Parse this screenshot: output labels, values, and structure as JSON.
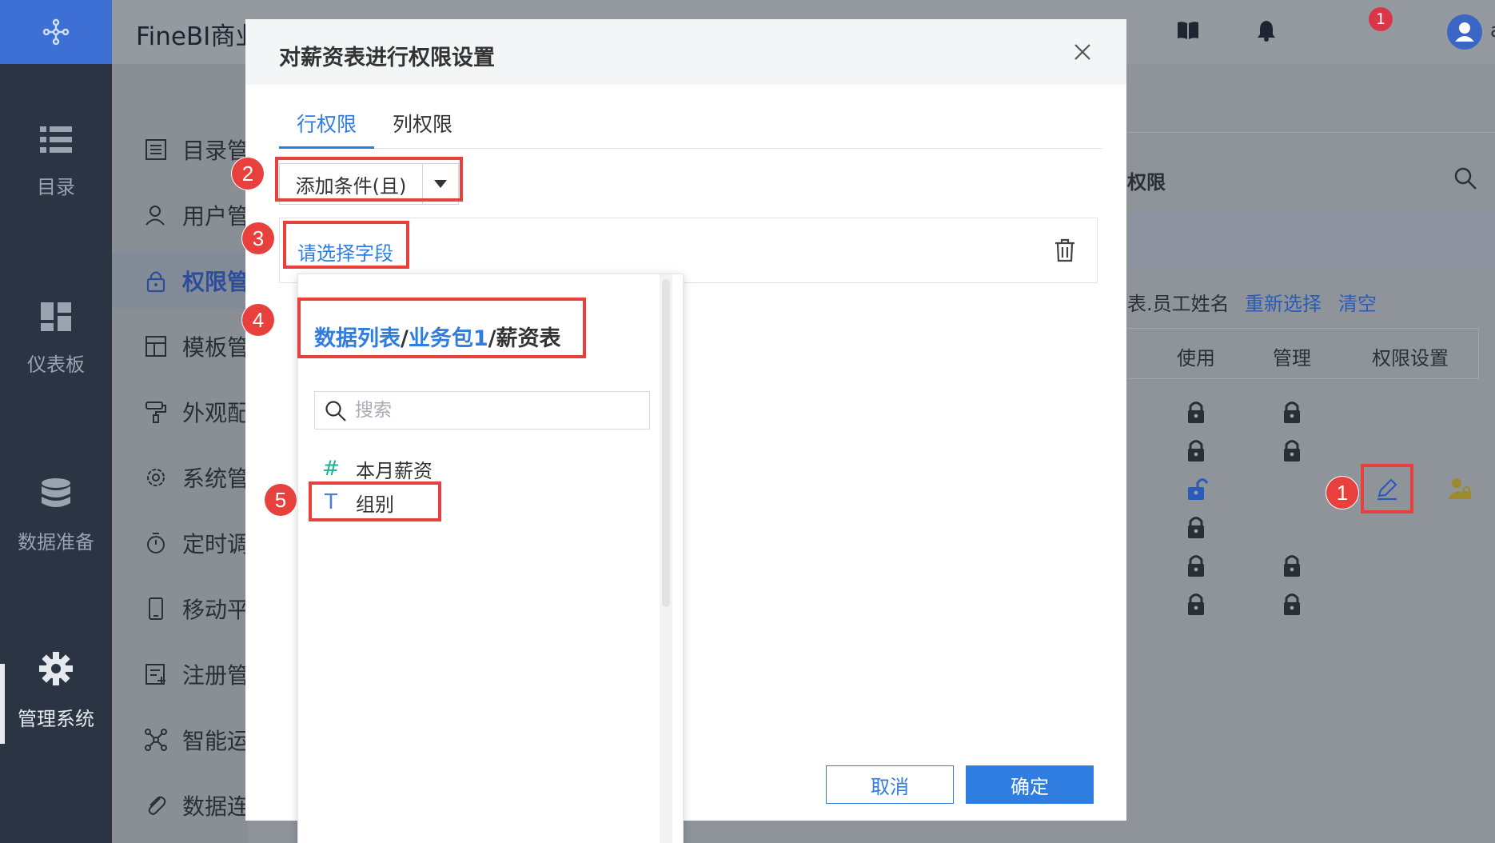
{
  "header": {
    "brand": "FineBI商业",
    "notification_count": "1",
    "username": "admin"
  },
  "nav": {
    "items": [
      {
        "label": "目录",
        "icon": "list-icon"
      },
      {
        "label": "仪表板",
        "icon": "dashboard-icon"
      },
      {
        "label": "数据准备",
        "icon": "database-icon"
      },
      {
        "label": "管理系统",
        "icon": "gear-icon"
      }
    ]
  },
  "sub_nav": {
    "items": [
      {
        "label": "目录管",
        "icon": "catalog-icon"
      },
      {
        "label": "用户管",
        "icon": "user-icon"
      },
      {
        "label": "权限管",
        "icon": "lock-icon"
      },
      {
        "label": "模板管",
        "icon": "template-icon"
      },
      {
        "label": "外观配",
        "icon": "paint-roller-icon"
      },
      {
        "label": "系统管",
        "icon": "settings-icon"
      },
      {
        "label": "定时调",
        "icon": "timer-icon"
      },
      {
        "label": "移动平",
        "icon": "mobile-icon"
      },
      {
        "label": "注册管",
        "icon": "register-icon"
      },
      {
        "label": "智能运",
        "icon": "network-icon"
      },
      {
        "label": "数据连",
        "icon": "link-icon"
      }
    ]
  },
  "background": {
    "panel_title": "权限",
    "field_text": "表.员工姓名",
    "reselect_link": "重新选择",
    "clear_link": "清空",
    "col_use": "使用",
    "col_manage": "管理",
    "col_perm": "权限设置"
  },
  "modal": {
    "title": "对薪资表进行权限设置",
    "tabs": [
      "行权限",
      "列权限"
    ],
    "add_condition": "添加条件(且)",
    "field_placeholder": "请选择字段",
    "breadcrumb": {
      "root": "数据列表",
      "sep": "/",
      "pkg": "业务包1",
      "table": "薪资表"
    },
    "search_placeholder": "搜索",
    "fields": [
      {
        "type": "#",
        "type_kind": "number",
        "name": "本月薪资"
      },
      {
        "type": "T",
        "type_kind": "text",
        "name": "组别"
      }
    ],
    "cancel": "取消",
    "confirm": "确定"
  },
  "annotations": [
    "1",
    "2",
    "3",
    "4",
    "5"
  ],
  "colors": {
    "accent": "#2f7de1",
    "annotation_red": "#e8413d",
    "nav_bg": "#2b3442",
    "nav_logo": "#3d6fd4"
  }
}
